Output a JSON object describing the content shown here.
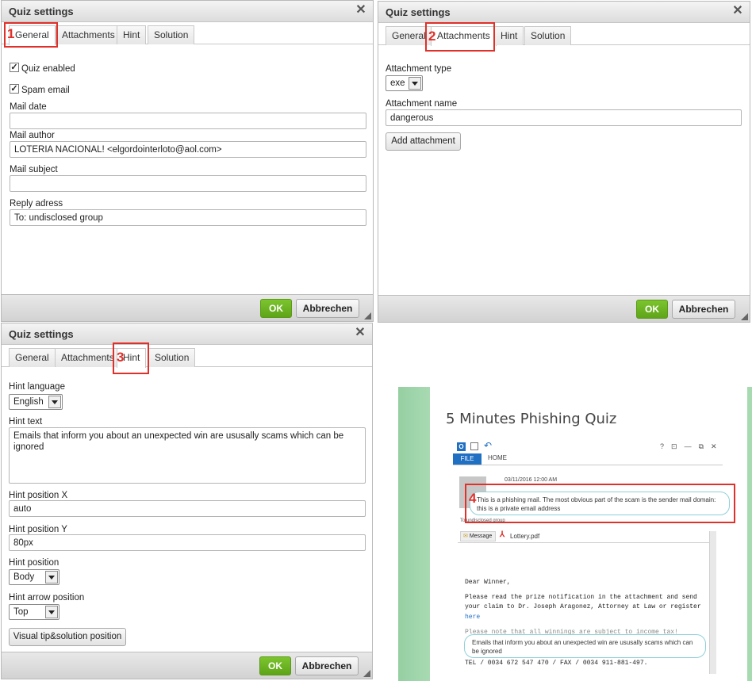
{
  "dialog": {
    "title": "Quiz settings",
    "close": "✕",
    "tabs": [
      "General",
      "Attachments",
      "Hint",
      "Solution"
    ],
    "ok": "OK",
    "cancel": "Abbrechen"
  },
  "callouts": [
    "1",
    "2",
    "3",
    "4"
  ],
  "general": {
    "quiz_enabled_label": "Quiz enabled",
    "quiz_enabled": true,
    "spam_email_label": "Spam email",
    "spam_email": true,
    "mail_date_label": "Mail date",
    "mail_date": "",
    "mail_author_label": "Mail author",
    "mail_author": "LOTERIA NACIONAL! <elgordointerloto@aol.com>",
    "mail_subject_label": "Mail subject",
    "mail_subject": "",
    "reply_label": "Reply adress",
    "reply": "To: undisclosed group"
  },
  "attachments": {
    "type_label": "Attachment type",
    "type_value": "exe",
    "name_label": "Attachment name",
    "name_value": "dangerous",
    "add_button": "Add attachment"
  },
  "hint": {
    "language_label": "Hint language",
    "language_value": "English",
    "text_label": "Hint text",
    "text_value": "Emails that inform you about an unexpected win are ususally scams which can be ignored",
    "pos_x_label": "Hint position X",
    "pos_x_value": "auto",
    "pos_y_label": "Hint position Y",
    "pos_y_value": "80px",
    "position_label": "Hint position",
    "position_value": "Body",
    "arrow_label": "Hint arrow position",
    "arrow_value": "Top",
    "visual_button": "Visual tip&solution position"
  },
  "preview": {
    "heading": "5 Minutes Phishing Quiz",
    "window_controls": [
      "?",
      "⊡",
      "—",
      "⧉",
      "✕"
    ],
    "ribbon_file": "FILE",
    "ribbon_home": "HOME",
    "date": "03/11/2016 12:00 AM",
    "bubble1": "This is a phishing mail. The most obvious part of the scam is the sender mail domain: this is a private email address",
    "to": "To undisclosed group",
    "message_tab": "Message",
    "attachment_file": "Lottery.pdf",
    "body_greeting": "Dear Winner,",
    "body_line1": "Please read the prize notification in the attachment and send",
    "body_line2": "your claim to Dr. Joseph Aragonez, Attorney at Law or register",
    "body_link": "here",
    "body_line3": "Please note that all winnings are subject to income tax!",
    "body_line4": "TEL / 0034 672 547 470 / FAX / 0034 911-881-497.",
    "bubble2": "Emails that inform you about an unexpected win are ususally scams which can be ignored"
  },
  "colors": {
    "callout": "#e0302a",
    "ok_button": "#6db524",
    "preview_accent": "#a8dab2",
    "bubble_border": "#8fd0d8"
  }
}
